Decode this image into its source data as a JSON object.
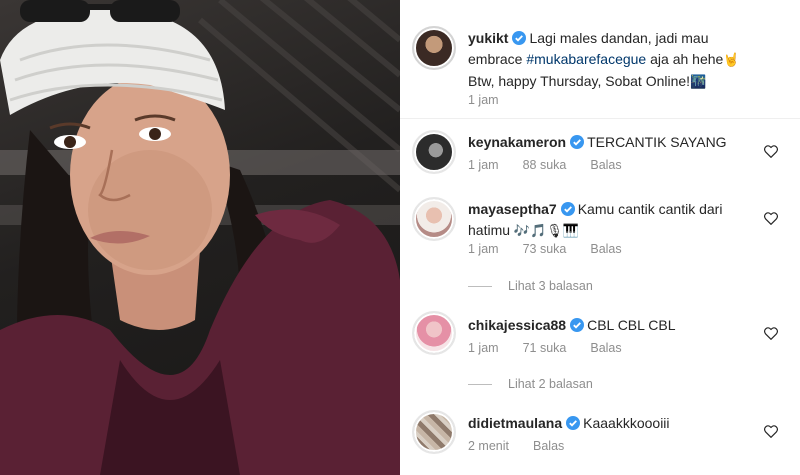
{
  "post": {
    "username": "yukikt",
    "caption_line1": "Lagi males dandan, jadi mau",
    "caption_pre": "embrace",
    "hashtag": "#mukabarefacegue",
    "caption_post": "aja ah hehe",
    "caption_emoji1": "🤘",
    "caption_line3": "Btw, happy Thursday, Sobat Online!",
    "caption_emoji2": "🌃",
    "time": "1 jam"
  },
  "comments": [
    {
      "username": "keynakameron",
      "text": "TERCANTIK SAYANG",
      "time": "1 jam",
      "likes": "88 suka",
      "reply": "Balas"
    },
    {
      "username": "mayaseptha7",
      "text": "Kamu cantik cantik dari",
      "text2": "hatimu",
      "emojis": "🎶🎵🎙🎹",
      "time": "1 jam",
      "likes": "73 suka",
      "reply": "Balas",
      "view_replies": "Lihat 3 balasan"
    },
    {
      "username": "chikajessica88",
      "text": "CBL CBL CBL",
      "time": "1 jam",
      "likes": "71 suka",
      "reply": "Balas",
      "view_replies": "Lihat 2 balasan"
    },
    {
      "username": "didietmaulana",
      "text": "Kaaakkkoooiii",
      "time": "2 menit",
      "reply": "Balas"
    }
  ],
  "icons": {
    "verified": "verified-badge-icon",
    "like": "heart-icon"
  },
  "colors": {
    "verified": "#3897f0",
    "hashtag": "#00376b",
    "muted": "#8e8e8e"
  }
}
